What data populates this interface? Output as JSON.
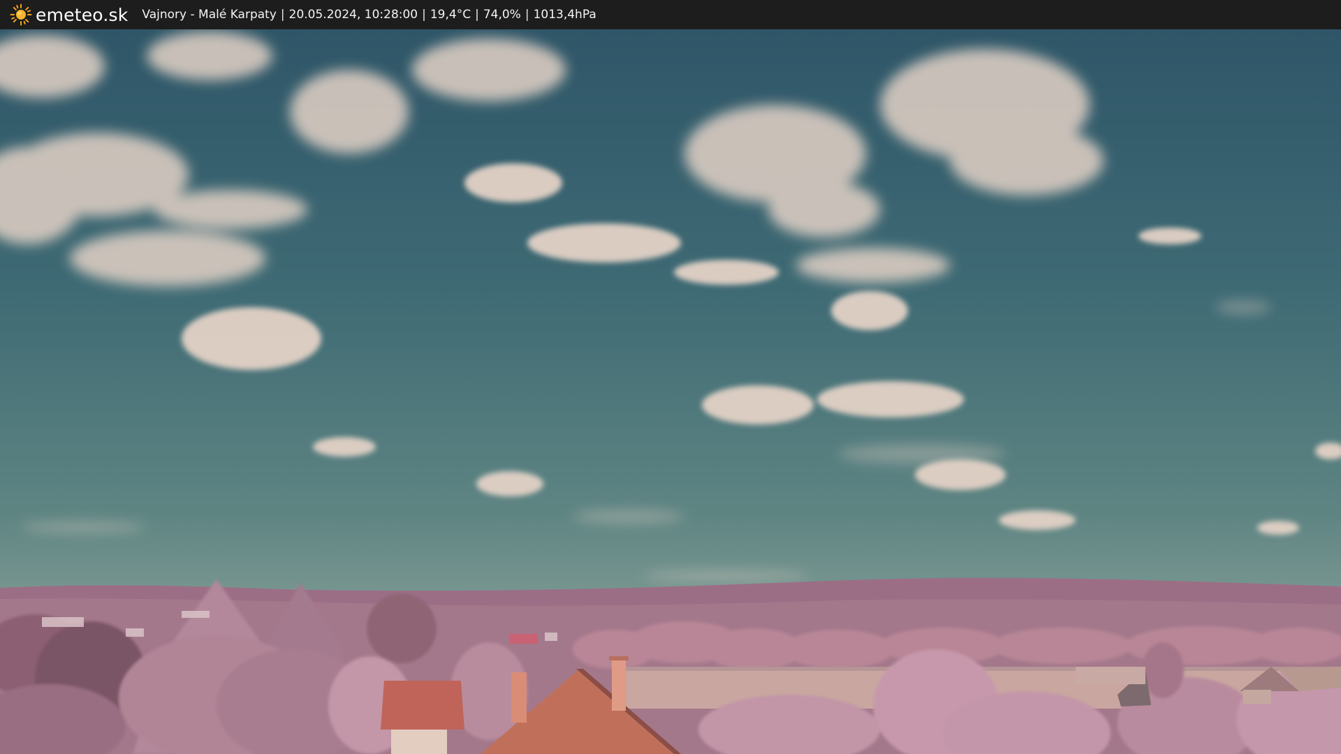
{
  "brand": {
    "name": "emeteo.sk",
    "icon": "sun-icon"
  },
  "caption": {
    "location": "Vajnory - Malé Karpaty",
    "datetime": "20.05.2024, 10:28:00",
    "temperature": "19,4°C",
    "humidity": "74,0%",
    "pressure": "1013,4hPa"
  },
  "colors": {
    "bar_background": "#1d1d1d",
    "sun": "#f5a31a",
    "sky_top": "#2f5869",
    "sky_horizon": "#6a8b86",
    "vegetation": "#b07c8f"
  }
}
